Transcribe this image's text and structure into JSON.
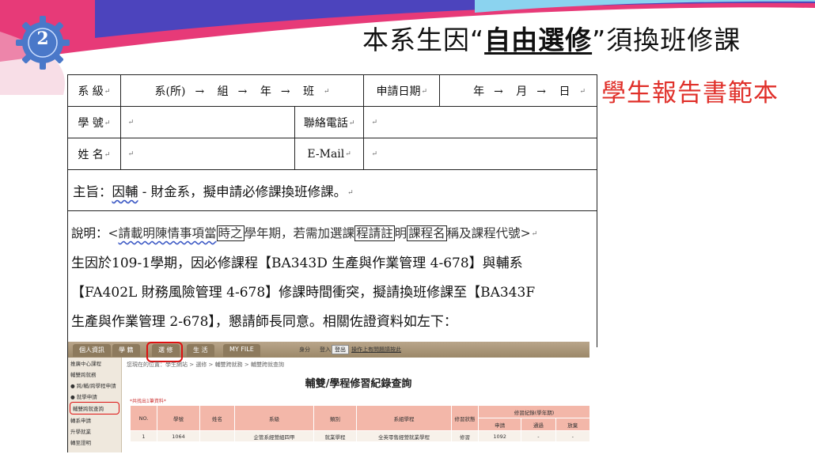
{
  "slide": {
    "badge_number": "2",
    "title_prefix": "本系生因",
    "title_quote_open": "“",
    "title_emphasis": "自由選修",
    "title_quote_close": "”",
    "title_suffix": "須換班修課",
    "subtitle": "學生報告書範本",
    "colors": {
      "accent_red": "#e0302a",
      "badge_blue": "#4a78c9",
      "swoosh_pink": "#e73a78"
    }
  },
  "form": {
    "row1": {
      "label": "系 級",
      "dept": "系(所)",
      "group": "組",
      "year": "年",
      "class": "班",
      "date_label": "申請日期",
      "date_y": "年",
      "date_m": "月",
      "date_d": "日",
      "arrow": "→"
    },
    "row2": {
      "label": "學 號",
      "phone_label": "聯絡電話"
    },
    "row3": {
      "label": "姓 名",
      "email_label": "E-Mail"
    },
    "subject": {
      "prefix": "主旨：",
      "underlined": "因輔",
      "middle": " - ",
      "rest": "財金系，擬申請必修課換班修課。"
    },
    "description": {
      "label": "說明：",
      "note_a": "<",
      "note_b": "請載明陳情事項當",
      "note_box1": "時之",
      "note_c": "學年期，若需加選課",
      "note_box2": "程請註",
      "note_d": "明",
      "note_box3": "課程名",
      "note_e": "稱及課程代號",
      "note_f": ">",
      "line1": "生因於109-1學期，因必修課程【BA343D 生產與作業管理 4-678】與輔系",
      "line2": "【FA402L 財務風險管理 4-678】修課時間衝突，擬請換班修課至【BA343F",
      "line3": "生產與作業管理 2-678】，懇請師長同意。相關佐證資料如左下："
    }
  },
  "web": {
    "tabs": [
      "個人資訊",
      "學 籍",
      "選 修",
      "生 活",
      "MY FILE"
    ],
    "bar_text": "身分",
    "bar_text2": "登入",
    "login_btn": "登出",
    "logout_link": "操作上有問題請按此",
    "side_items": [
      "推廣中心課程",
      "輔雙跨就務",
      "● 跨/輔/跨學程申請",
      "● 就學申請",
      "輔雙跨就查詢",
      "轉系申請",
      "升學就業",
      "轉至證明"
    ],
    "crumb": "您現在的位置：學生網站 > 選修 > 輔雙跨就務 > 輔雙跨就查詢",
    "heading": "輔雙/學程修習紀錄查詢",
    "count": "*共找出1筆資料*",
    "headers": [
      "NO.",
      "學號",
      "姓名",
      "系級",
      "類別",
      "系組學程",
      "修習狀態",
      "修習紀錄(學年期)"
    ],
    "sub_headers": [
      "申請",
      "通過",
      "放棄"
    ],
    "row": [
      "1",
      "1064",
      "",
      "企管系經營組四甲",
      "就業學程",
      "全英零售經營就業學程",
      "修習",
      "1092",
      "-",
      "-"
    ]
  }
}
